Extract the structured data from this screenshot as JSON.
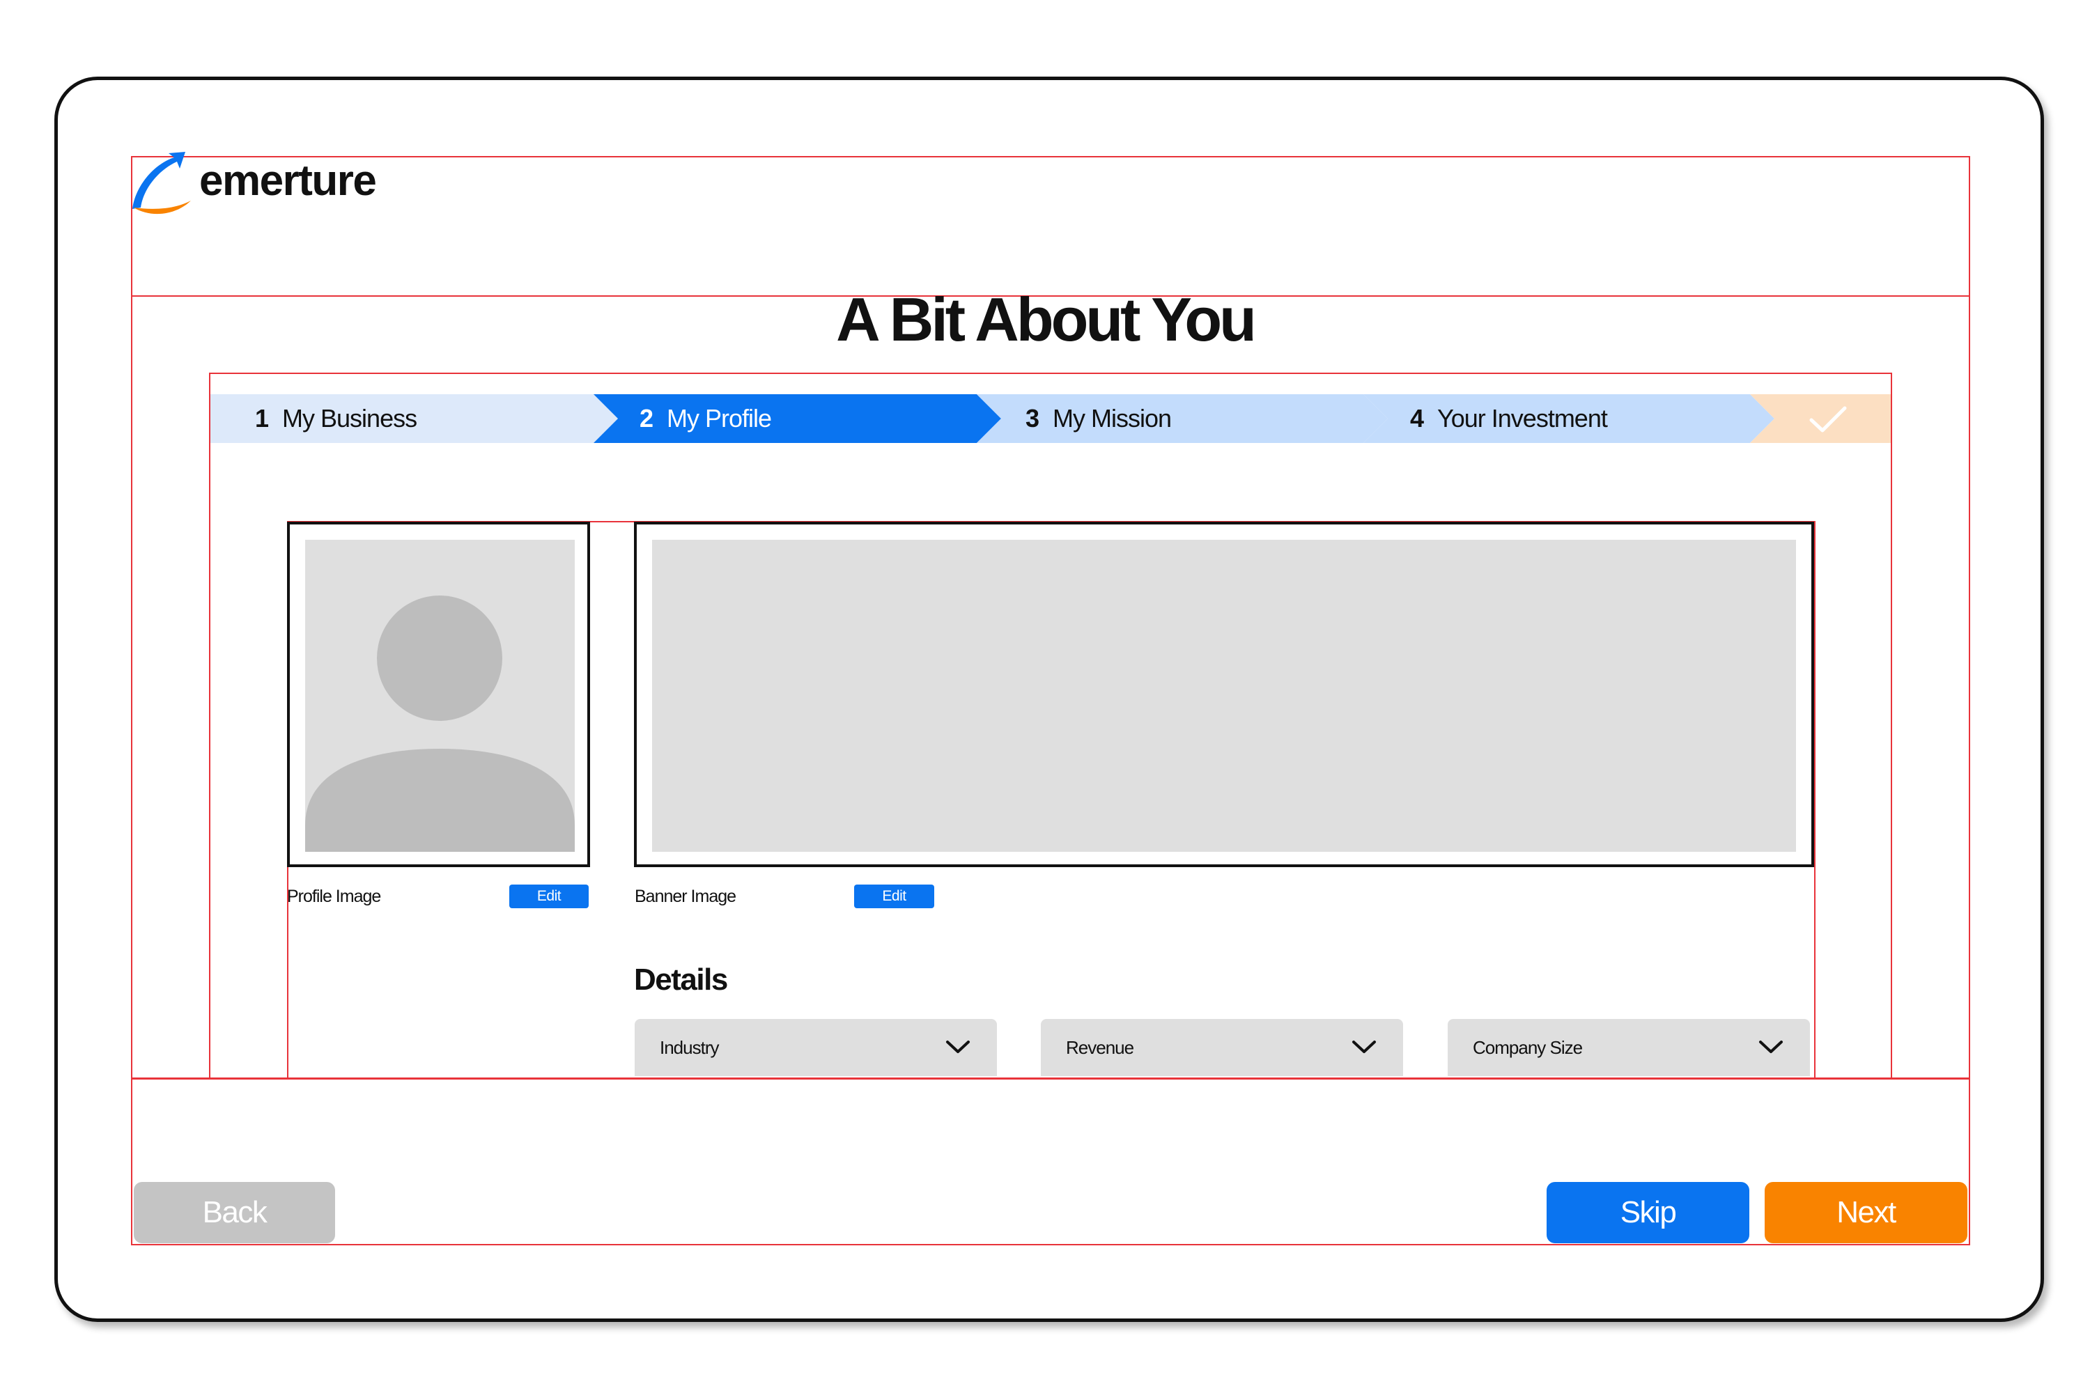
{
  "brand": {
    "name": "emerture",
    "logo_mark": "swoosh-arrow-logo",
    "colors": {
      "blue": "#0a74f0",
      "orange": "#f98300"
    }
  },
  "page": {
    "title": "A Bit About You"
  },
  "stepper": {
    "steps": [
      {
        "number": "1",
        "label": "My Business",
        "state": "completed",
        "color": "#dde9fa"
      },
      {
        "number": "2",
        "label": "My Profile",
        "state": "active",
        "color": "#0a74f0"
      },
      {
        "number": "3",
        "label": "My Mission",
        "state": "upcoming",
        "color": "#c3dcfc"
      },
      {
        "number": "4",
        "label": "Your Investment",
        "state": "upcoming",
        "color": "#c3dcfc"
      }
    ],
    "final_step": {
      "icon": "checkmark-icon",
      "color": "#fcdfc2"
    }
  },
  "profile_image": {
    "label": "Profile Image",
    "edit_label": "Edit",
    "placeholder_icon": "avatar-placeholder-icon"
  },
  "banner_image": {
    "label": "Banner Image",
    "edit_label": "Edit"
  },
  "details": {
    "heading": "Details",
    "dropdowns": [
      {
        "placeholder": "Industry"
      },
      {
        "placeholder": "Revenue"
      },
      {
        "placeholder": "Company Size"
      }
    ]
  },
  "footer": {
    "back_label": "Back",
    "skip_label": "Skip",
    "next_label": "Next",
    "colors": {
      "back": "#c4c4c4",
      "skip": "#0a74f0",
      "next": "#f98300"
    }
  },
  "annotation_guide_color": "#e8333a"
}
